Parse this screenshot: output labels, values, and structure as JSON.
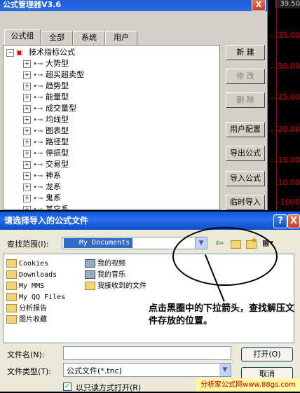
{
  "chart": {
    "top_value": "39.50",
    "ticks": [
      "35.00",
      "30.00",
      "25.00",
      "20.00",
      "15.00",
      "10.00",
      "-1000"
    ]
  },
  "manager": {
    "title": "公式管理器V3.6",
    "close_glyph": "X",
    "tabs": [
      "公式组",
      "全部",
      "系统",
      "用户"
    ],
    "tree_root": "技术指标公式",
    "tree_items": [
      "大势型",
      "超买超卖型",
      "趋势型",
      "能量型",
      "成交量型",
      "均线型",
      "图表型",
      "路径型",
      "停损型",
      "交易型",
      "神系",
      "龙系",
      "鬼系",
      "其它系"
    ],
    "buttons": {
      "new": "新  建",
      "edit": "修  改",
      "delete": "删  除",
      "user_config": "用户配置",
      "export": "导出公式",
      "import": "导入公式",
      "temp_import": "临时导入"
    }
  },
  "dialog": {
    "title": "请选择导入的公式文件",
    "help_glyph": "?",
    "close_glyph": "X",
    "look_in_label": "查找范围(I):",
    "look_in_value": "My Documents",
    "file_items_col1": [
      "Cookies",
      "Downloads",
      "My MMS",
      "My QQ Files",
      "分析报告",
      "图片收藏"
    ],
    "file_items_col2": [
      "我的视频",
      "我的音乐",
      "我接收到的文件"
    ],
    "filename_label": "文件名(N):",
    "filename_value": "",
    "filetype_label": "文件类型(T):",
    "filetype_value": "公式文件(*.tnc)",
    "readonly_label": "以只读方式打开(R)",
    "open_button": "打开(O)",
    "cancel_button": "取消"
  },
  "annotation": {
    "callout": "点击黑圈中的下拉箭头，查找解压文件存放的位置。",
    "watermark": "分析家公式网www.88gs.com"
  }
}
